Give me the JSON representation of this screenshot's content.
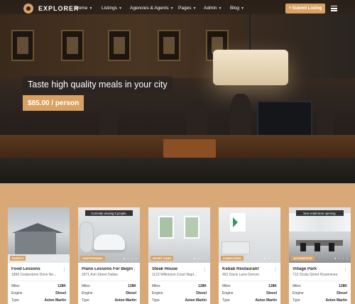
{
  "nav": {
    "brand": "EXPLORER",
    "items": [
      {
        "label": "Home"
      },
      {
        "label": "Listings"
      },
      {
        "label": "Agencies & Agents"
      },
      {
        "label": "Pages"
      },
      {
        "label": "Admin"
      },
      {
        "label": "Blog"
      }
    ],
    "submit_label": "+ Submit Listing"
  },
  "hero": {
    "headline": "Taste high quality meals in your city",
    "price": "$85.00 / person"
  },
  "colors": {
    "accent": "#d9a263",
    "page_background": "#d9a877"
  },
  "cards": [
    {
      "category": "EVENTS",
      "banner": "",
      "title": "Food Lessons",
      "address": "1890 Cedarstone Drive Ne...",
      "rows": [
        {
          "label": "Miles",
          "value": "128K"
        },
        {
          "label": "Engine",
          "value": "Diesel"
        },
        {
          "label": "Type",
          "value": "Aston Martin"
        }
      ]
    },
    {
      "category": "GASTRONOMY",
      "banner": "Currently viewing 8 people.",
      "title": "Piano Lessons For Beginn...",
      "address": "3071 Ash Street Dallas",
      "rows": [
        {
          "label": "Miles",
          "value": "128K"
        },
        {
          "label": "Engine",
          "value": "Diesel"
        },
        {
          "label": "Type",
          "value": "Aston Martin"
        }
      ]
    },
    {
      "category": "SPORT CARS",
      "banner": "",
      "title": "Steak House",
      "address": "1122 Wilkinson Court Napl...",
      "rows": [
        {
          "label": "Miles",
          "value": "128K"
        },
        {
          "label": "Engine",
          "value": "Diesel"
        },
        {
          "label": "Type",
          "value": "Aston Martin"
        }
      ]
    },
    {
      "category": "COMPUTERS",
      "banner": "",
      "title": "Kebab Restaurant",
      "address": "463 Davis Lane Denver",
      "rows": [
        {
          "label": "Miles",
          "value": "128K"
        },
        {
          "label": "Engine",
          "value": "Diesel"
        },
        {
          "label": "Type",
          "value": "Aston Martin"
        }
      ]
    },
    {
      "category": "AUTOMOTIVE",
      "banner": "New retail store opening.",
      "title": "Village Park",
      "address": "712 Ocala Street Kissimmee",
      "rows": [
        {
          "label": "Miles",
          "value": "128K"
        },
        {
          "label": "Engine",
          "value": "Diesel"
        },
        {
          "label": "Type",
          "value": "Aston Martin"
        }
      ]
    }
  ]
}
